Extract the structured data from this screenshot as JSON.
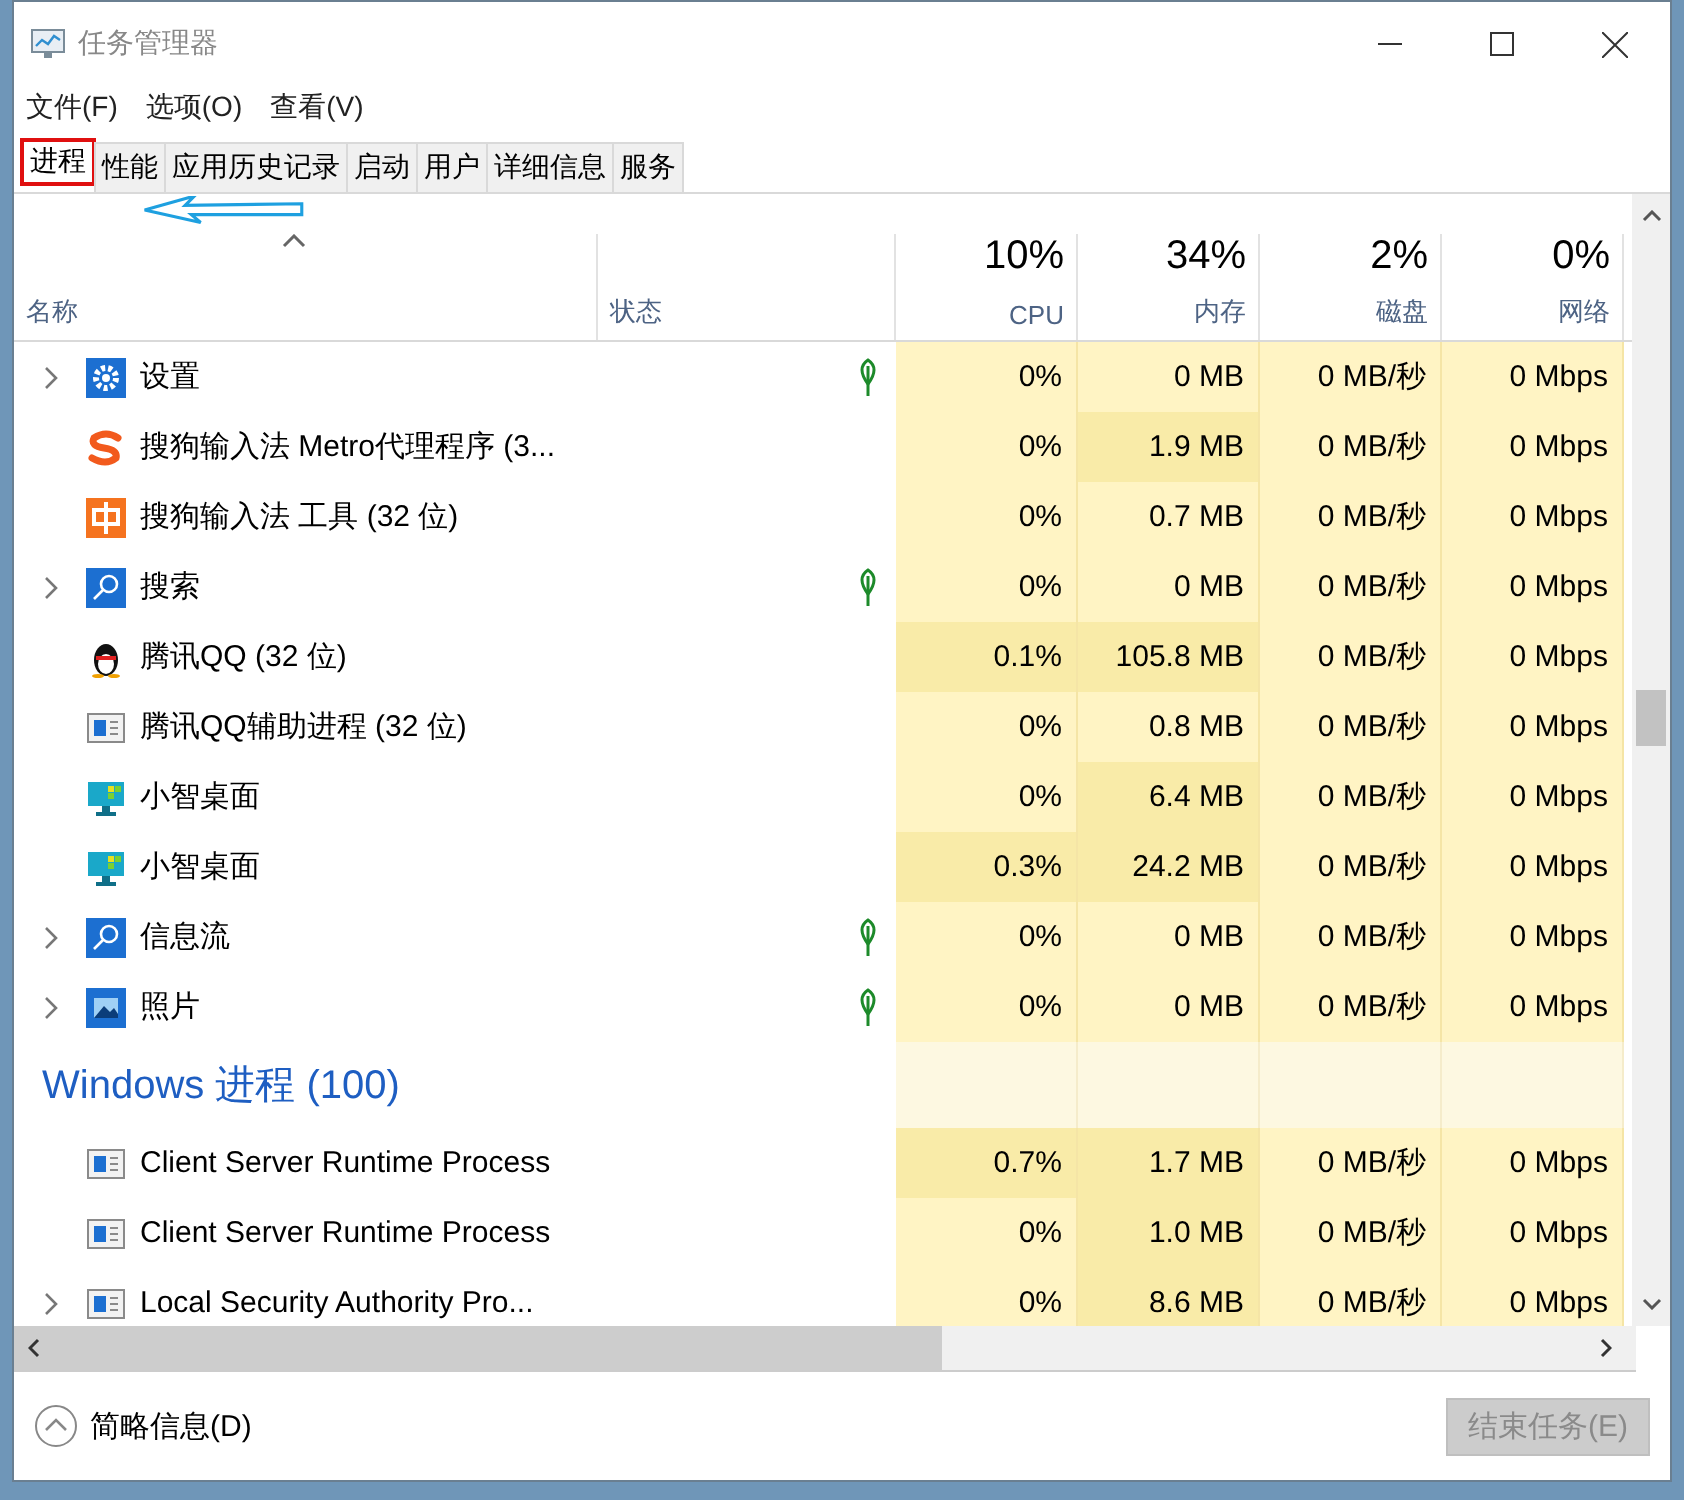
{
  "window": {
    "title": "任务管理器"
  },
  "menu": [
    "文件(F)",
    "选项(O)",
    "查看(V)"
  ],
  "tabs": [
    {
      "label": "进程",
      "selected": true
    },
    {
      "label": "性能",
      "selected": false
    },
    {
      "label": "应用历史记录",
      "selected": false
    },
    {
      "label": "启动",
      "selected": false
    },
    {
      "label": "用户",
      "selected": false
    },
    {
      "label": "详细信息",
      "selected": false
    },
    {
      "label": "服务",
      "selected": false
    }
  ],
  "columns": {
    "name": "名称",
    "status": "状态",
    "metrics": [
      {
        "total": "10%",
        "label": "CPU"
      },
      {
        "total": "34%",
        "label": "内存"
      },
      {
        "total": "2%",
        "label": "磁盘"
      },
      {
        "total": "0%",
        "label": "网络"
      }
    ]
  },
  "rows": [
    {
      "kind": "process",
      "name": "设置",
      "expandable": true,
      "suspended": true,
      "cells": [
        {
          "text": "0%",
          "hot": false
        },
        {
          "text": "0 MB",
          "hot": false
        },
        {
          "text": "0 MB/秒",
          "hot": false
        },
        {
          "text": "0 Mbps",
          "hot": false
        }
      ]
    },
    {
      "kind": "process",
      "name": "搜狗输入法 Metro代理程序 (3...",
      "expandable": false,
      "suspended": false,
      "cells": [
        {
          "text": "0%",
          "hot": false
        },
        {
          "text": "1.9 MB",
          "hot": true
        },
        {
          "text": "0 MB/秒",
          "hot": false
        },
        {
          "text": "0 Mbps",
          "hot": false
        }
      ]
    },
    {
      "kind": "process",
      "name": "搜狗输入法 工具 (32 位)",
      "expandable": false,
      "suspended": false,
      "cells": [
        {
          "text": "0%",
          "hot": false
        },
        {
          "text": "0.7 MB",
          "hot": false
        },
        {
          "text": "0 MB/秒",
          "hot": false
        },
        {
          "text": "0 Mbps",
          "hot": false
        }
      ]
    },
    {
      "kind": "process",
      "name": "搜索",
      "expandable": true,
      "suspended": true,
      "cells": [
        {
          "text": "0%",
          "hot": false
        },
        {
          "text": "0 MB",
          "hot": false
        },
        {
          "text": "0 MB/秒",
          "hot": false
        },
        {
          "text": "0 Mbps",
          "hot": false
        }
      ]
    },
    {
      "kind": "process",
      "name": "腾讯QQ (32 位)",
      "expandable": false,
      "suspended": false,
      "cells": [
        {
          "text": "0.1%",
          "hot": true
        },
        {
          "text": "105.8 MB",
          "hot": true
        },
        {
          "text": "0 MB/秒",
          "hot": false
        },
        {
          "text": "0 Mbps",
          "hot": false
        }
      ]
    },
    {
      "kind": "process",
      "name": "腾讯QQ辅助进程 (32 位)",
      "expandable": false,
      "suspended": false,
      "cells": [
        {
          "text": "0%",
          "hot": false
        },
        {
          "text": "0.8 MB",
          "hot": false
        },
        {
          "text": "0 MB/秒",
          "hot": false
        },
        {
          "text": "0 Mbps",
          "hot": false
        }
      ]
    },
    {
      "kind": "process",
      "name": "小智桌面",
      "expandable": false,
      "suspended": false,
      "cells": [
        {
          "text": "0%",
          "hot": false
        },
        {
          "text": "6.4 MB",
          "hot": true
        },
        {
          "text": "0 MB/秒",
          "hot": false
        },
        {
          "text": "0 Mbps",
          "hot": false
        }
      ]
    },
    {
      "kind": "process",
      "name": "小智桌面",
      "expandable": false,
      "suspended": false,
      "cells": [
        {
          "text": "0.3%",
          "hot": true
        },
        {
          "text": "24.2 MB",
          "hot": true
        },
        {
          "text": "0 MB/秒",
          "hot": false
        },
        {
          "text": "0 Mbps",
          "hot": false
        }
      ]
    },
    {
      "kind": "process",
      "name": "信息流",
      "expandable": true,
      "suspended": true,
      "cells": [
        {
          "text": "0%",
          "hot": false
        },
        {
          "text": "0 MB",
          "hot": false
        },
        {
          "text": "0 MB/秒",
          "hot": false
        },
        {
          "text": "0 Mbps",
          "hot": false
        }
      ]
    },
    {
      "kind": "process",
      "name": "照片",
      "expandable": true,
      "suspended": true,
      "cells": [
        {
          "text": "0%",
          "hot": false
        },
        {
          "text": "0 MB",
          "hot": false
        },
        {
          "text": "0 MB/秒",
          "hot": false
        },
        {
          "text": "0 Mbps",
          "hot": false
        }
      ]
    },
    {
      "kind": "group",
      "name": "Windows 进程 (100)"
    },
    {
      "kind": "process",
      "name": "Client Server Runtime Process",
      "expandable": false,
      "suspended": false,
      "cells": [
        {
          "text": "0.7%",
          "hot": true
        },
        {
          "text": "1.7 MB",
          "hot": true
        },
        {
          "text": "0 MB/秒",
          "hot": false
        },
        {
          "text": "0 Mbps",
          "hot": false
        }
      ]
    },
    {
      "kind": "process",
      "name": "Client Server Runtime Process",
      "expandable": false,
      "suspended": false,
      "cells": [
        {
          "text": "0%",
          "hot": false
        },
        {
          "text": "1.0 MB",
          "hot": true
        },
        {
          "text": "0 MB/秒",
          "hot": false
        },
        {
          "text": "0 Mbps",
          "hot": false
        }
      ]
    },
    {
      "kind": "process",
      "name": "Local Security Authority Pro...",
      "expandable": true,
      "suspended": false,
      "cells": [
        {
          "text": "0%",
          "hot": false
        },
        {
          "text": "8.6 MB",
          "hot": true
        },
        {
          "text": "0 MB/秒",
          "hot": false
        },
        {
          "text": "0 Mbps",
          "hot": false
        }
      ]
    }
  ],
  "footer": {
    "fewer_details": "简略信息(D)",
    "end_task": {
      "label": "结束任务(E)",
      "disabled": true
    }
  }
}
